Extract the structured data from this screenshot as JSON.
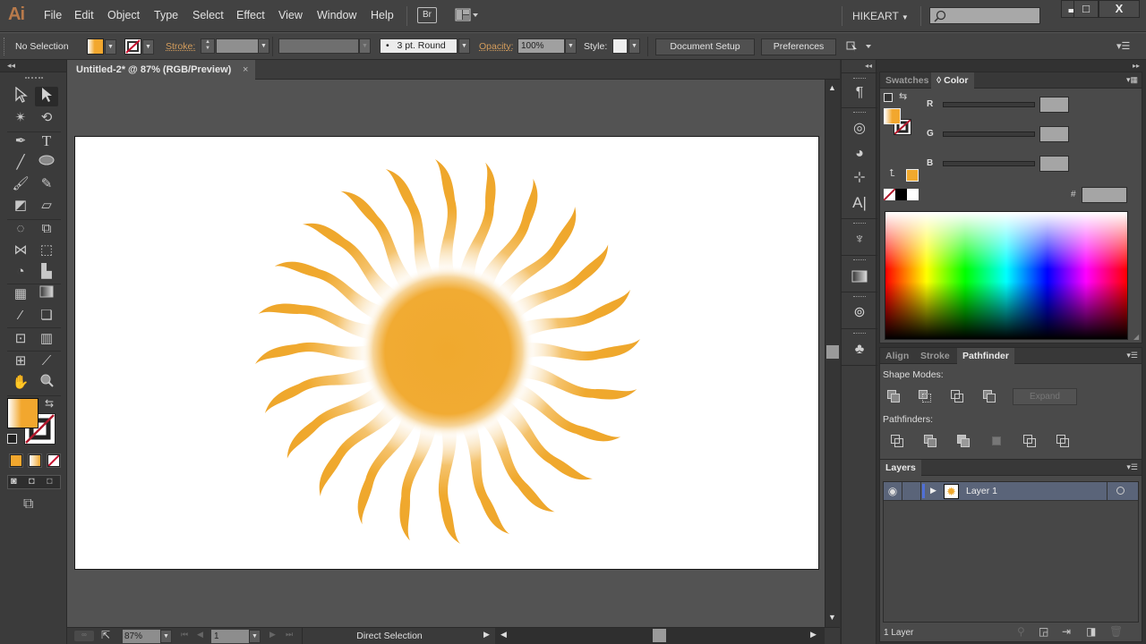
{
  "app": {
    "logo": "Ai",
    "menu": [
      "File",
      "Edit",
      "Object",
      "Type",
      "Select",
      "Effect",
      "View",
      "Window",
      "Help"
    ],
    "bridge_label": "Br",
    "workspace": "HIKEART",
    "search_placeholder": "",
    "window_controls": {
      "minimize": "▬",
      "maximize": "□",
      "close": "X"
    }
  },
  "control_bar": {
    "selection_status": "No Selection",
    "fill_color": "#f2a72e",
    "stroke_label": "Stroke:",
    "stroke_weight": "",
    "variable_width": "",
    "brush": "3 pt. Round",
    "brush_bullet": "•",
    "opacity_label": "Opacity:",
    "opacity_value": "100%",
    "style_label": "Style:",
    "document_setup": "Document Setup",
    "preferences": "Preferences"
  },
  "document": {
    "tab_title": "Untitled-2* @ 87% (RGB/Preview)",
    "tab_close": "×",
    "artwork": {
      "name": "sun",
      "fill_color": "#f0a92e",
      "ray_count": 24
    }
  },
  "status_bar": {
    "zoom": "87%",
    "artboard_number": "1",
    "current_tool": "Direct Selection"
  },
  "tools_panel": {
    "collapse": "◂◂",
    "fill_color": "#f2a72e"
  },
  "color_panel": {
    "tabs": [
      "Swatches",
      "◊ Color"
    ],
    "active_tab": "Color",
    "channels": [
      {
        "label": "R",
        "value": ""
      },
      {
        "label": "G",
        "value": ""
      },
      {
        "label": "B",
        "value": ""
      }
    ],
    "hex_label": "#",
    "hex_value": "",
    "out_of_gamut_color": "#f0a92e"
  },
  "pathfinder_panel": {
    "tabs": [
      "Align",
      "Stroke",
      "Pathfinder"
    ],
    "active_tab": "Pathfinder",
    "shape_modes_label": "Shape Modes:",
    "expand_label": "Expand",
    "pathfinders_label": "Pathfinders:"
  },
  "layers_panel": {
    "tab": "Layers",
    "layers": [
      {
        "name": "Layer 1",
        "visible": true,
        "color": "#4f6fd6"
      }
    ],
    "footer_count": "1 Layer"
  }
}
